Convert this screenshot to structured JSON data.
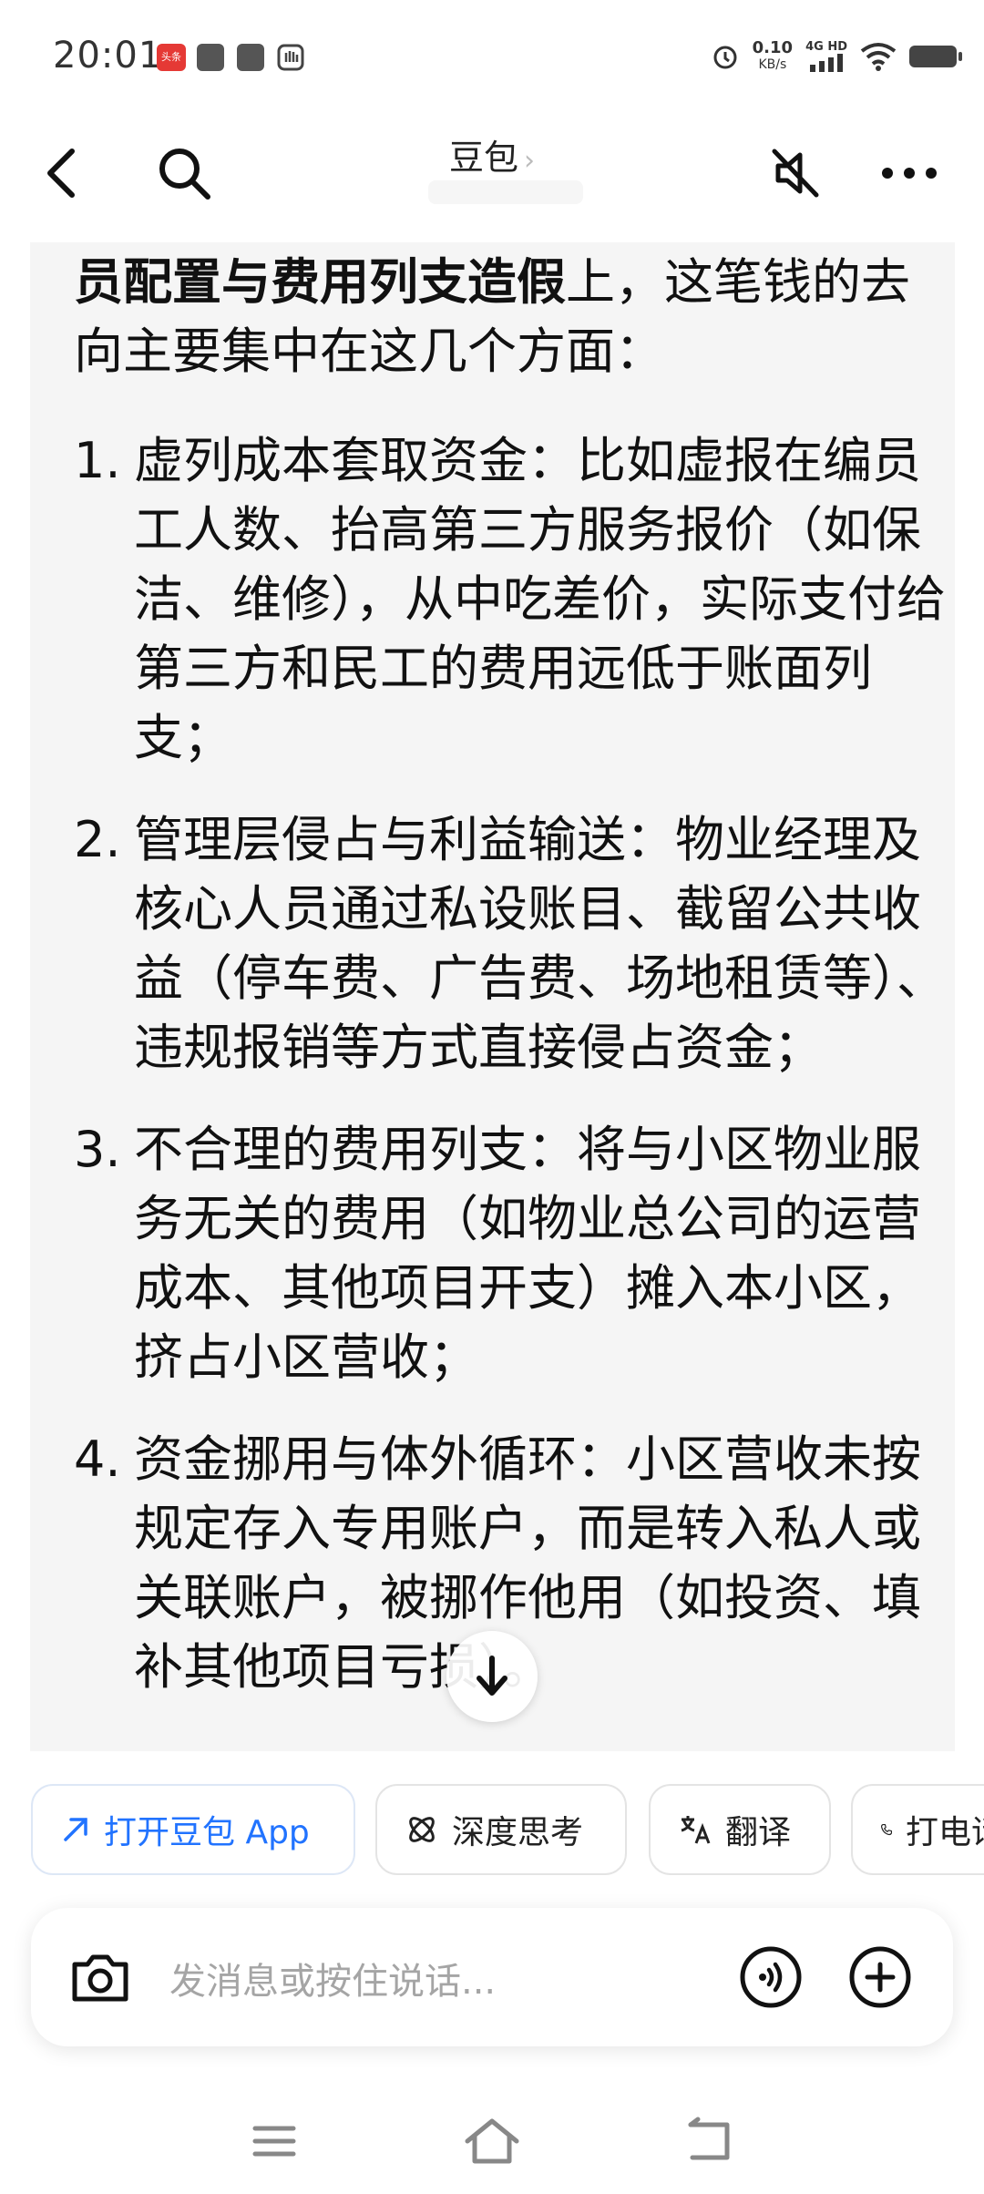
{
  "status_bar": {
    "time": "20:01",
    "app_badge": "头条",
    "net_speed_value": "0.10",
    "net_speed_unit": "KB/s",
    "network": "4G HD"
  },
  "header": {
    "title": "豆包",
    "title_chevron": "›"
  },
  "message": {
    "intro_bold": "员配置与费用列支造假",
    "intro_rest": "上，这笔钱的去向主要集中在这几个方面：",
    "items": [
      {
        "num": "1.",
        "text": "虚列成本套取资金：比如虚报在编员工人数、抬高第三方服务报价（如保洁、维修），从中吃差价，实际支付给第三方和民工的费用远低于账面列支；"
      },
      {
        "num": "2.",
        "text": "管理层侵占与利益输送：物业经理及核心人员通过私设账目、截留公共收益（停车费、广告费、场地租赁等）、违规报销等方式直接侵占资金；"
      },
      {
        "num": "3.",
        "text": "不合理的费用列支：将与小区物业服务无关的费用（如物业总公司的运营成本、其他项目开支）摊入本小区，挤占小区营收；"
      },
      {
        "num": "4.",
        "text": "资金挪用与体外循环：小区营收未按规定存入专用账户，而是转入私人或关联账户，被挪作他用（如投资、填补其他项目亏损）。"
      }
    ]
  },
  "chips": {
    "open_app": "打开豆包 App",
    "deep_think": "深度思考",
    "translate": "翻译",
    "call": "打电话"
  },
  "input": {
    "placeholder": "发消息或按住说话..."
  },
  "icons": {
    "back": "back-arrow-icon",
    "search": "search-icon",
    "mute": "speaker-muted-icon",
    "more": "more-dots-icon",
    "camera": "camera-icon",
    "voice": "voice-call-icon",
    "plus": "plus-circle-icon"
  },
  "colors": {
    "accent": "#2173ff",
    "message_bg": "#f5f5f5"
  }
}
